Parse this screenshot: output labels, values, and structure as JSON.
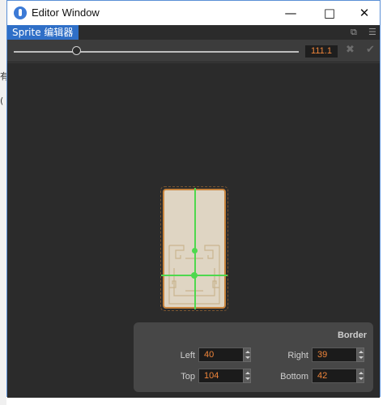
{
  "window": {
    "title": "Editor Window",
    "minimize_icon": "minimize-icon",
    "maximize_icon": "maximize-icon",
    "close_icon": "close-icon"
  },
  "tab": {
    "label": "Sprite 编辑器"
  },
  "toolbar": {
    "zoom_value": "111.1",
    "zoom_slider_fraction": 0.22,
    "cancel_icon": "x-icon",
    "confirm_icon": "check-icon"
  },
  "background": {
    "glyph_1": "有",
    "glyph_2": "("
  },
  "border": {
    "title": "Border",
    "left_label": "Left",
    "left_value": "40",
    "right_label": "Right",
    "right_value": "39",
    "top_label": "Top",
    "top_value": "104",
    "bottom_label": "Bottom",
    "bottom_value": "42"
  },
  "colors": {
    "accent_blue": "#2f6fc7",
    "guide_green": "#4ed84e",
    "value_orange": "#f0853a",
    "sprite_fill": "#dfd5c3"
  }
}
